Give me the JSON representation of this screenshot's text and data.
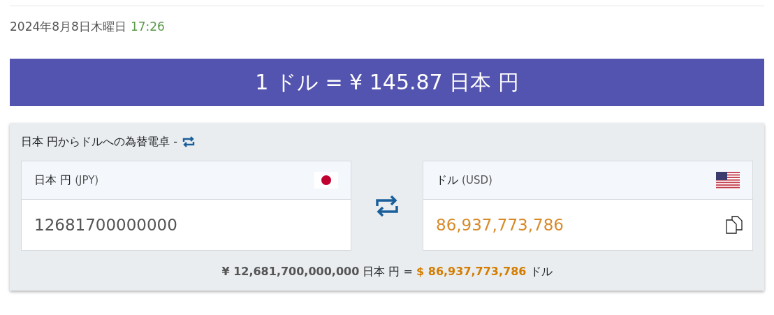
{
  "date": {
    "text": "2024年8月8日木曜日",
    "time": "17:26"
  },
  "rate_banner": "1 ドル = ¥ 145.87 日本 円",
  "converter": {
    "title": "日本 円からドルへの為替電卓 -",
    "from": {
      "name": "日本 円",
      "code": "(JPY)",
      "kind": "jp",
      "value": "12681700000000"
    },
    "to": {
      "name": "ドル",
      "code": "(USD)",
      "kind": "us",
      "value": "86,937,773,786"
    },
    "summary": "**¥ 12,681,700,000,000** 日本 円 = **$ 86,937,773,786** ドル"
  }
}
